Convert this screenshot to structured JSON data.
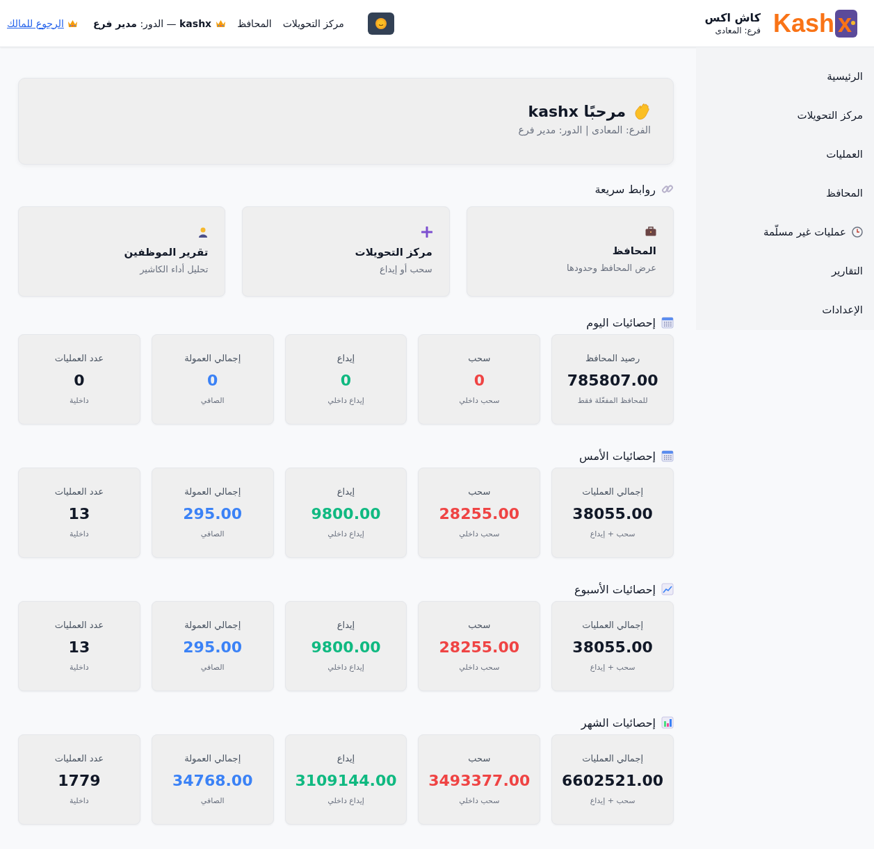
{
  "header": {
    "brand_logo": "Kash",
    "brand_logo_x": "x",
    "brand_name": "كاش اكس",
    "branch": "فرع: المعادى",
    "nav_links": [
      "مركز التحويلات",
      "المحافظ"
    ],
    "user_info": "**kashx** — الدور: **مدير فرع**",
    "back_link": "الرجوع للمالك"
  },
  "sidebar": {
    "items": [
      {
        "label": "الرئيسية",
        "kind": "plain"
      },
      {
        "label": "مركز التحويلات",
        "kind": "plain"
      },
      {
        "label": "العمليات",
        "kind": "plain"
      },
      {
        "label": "المحافظ",
        "kind": "plain"
      },
      {
        "label": "عمليات غير مسلّمة",
        "kind": "clock"
      },
      {
        "label": "التقارير",
        "kind": "plain"
      },
      {
        "label": "الإعدادات",
        "kind": "plain"
      }
    ]
  },
  "welcome": {
    "title": "مرحبًا kashx",
    "subtitle": "الفرع: المعادى | الدور: مدير فرع"
  },
  "quick_links": {
    "title": "روابط سريعة",
    "items": [
      {
        "title": "المحافظ",
        "subtitle": "عرض المحافظ وحدودها",
        "kind": "briefcase"
      },
      {
        "title": "مركز التحويلات",
        "subtitle": "سحب أو إيداع",
        "kind": "plus"
      },
      {
        "title": "تقرير الموظفين",
        "subtitle": "تحليل أداء الكاشير",
        "kind": "person"
      }
    ]
  },
  "sections": [
    {
      "title": "إحصائيات اليوم",
      "kind": "calendar",
      "stats": [
        {
          "label": "رصيد المحافظ",
          "value": "785807.00",
          "note": "للمحافظ المفعّلة فقط",
          "kind": "total"
        },
        {
          "label": "سحب",
          "value": "0",
          "note": "سحب داخلي",
          "kind": "withdraw"
        },
        {
          "label": "إيداع",
          "value": "0",
          "note": "إيداع داخلي",
          "kind": "deposit"
        },
        {
          "label": "إجمالي العمولة",
          "value": "0",
          "note": "الصافي",
          "kind": "commission"
        },
        {
          "label": "عدد العمليات",
          "value": "0",
          "note": "داخلية",
          "kind": "count"
        }
      ]
    },
    {
      "title": "إحصائيات الأمس",
      "kind": "calendar",
      "stats": [
        {
          "label": "إجمالي العمليات",
          "value": "38055.00",
          "note": "سحب + إيداع",
          "kind": "total"
        },
        {
          "label": "سحب",
          "value": "28255.00",
          "note": "سحب داخلي",
          "kind": "withdraw"
        },
        {
          "label": "إيداع",
          "value": "9800.00",
          "note": "إيداع داخلي",
          "kind": "deposit"
        },
        {
          "label": "إجمالي العمولة",
          "value": "295.00",
          "note": "الصافي",
          "kind": "commission"
        },
        {
          "label": "عدد العمليات",
          "value": "13",
          "note": "داخلية",
          "kind": "count"
        }
      ]
    },
    {
      "title": "إحصائيات الأسبوع",
      "kind": "trend",
      "stats": [
        {
          "label": "إجمالي العمليات",
          "value": "38055.00",
          "note": "سحب + إيداع",
          "kind": "total"
        },
        {
          "label": "سحب",
          "value": "28255.00",
          "note": "سحب داخلي",
          "kind": "withdraw"
        },
        {
          "label": "إيداع",
          "value": "9800.00",
          "note": "إيداع داخلي",
          "kind": "deposit"
        },
        {
          "label": "إجمالي العمولة",
          "value": "295.00",
          "note": "الصافي",
          "kind": "commission"
        },
        {
          "label": "عدد العمليات",
          "value": "13",
          "note": "داخلية",
          "kind": "count"
        }
      ]
    },
    {
      "title": "إحصائيات الشهر",
      "kind": "bars",
      "stats": [
        {
          "label": "إجمالي العمليات",
          "value": "6602521.00",
          "note": "سحب + إيداع",
          "kind": "total"
        },
        {
          "label": "سحب",
          "value": "3493377.00",
          "note": "سحب داخلي",
          "kind": "withdraw"
        },
        {
          "label": "إيداع",
          "value": "3109144.00",
          "note": "إيداع داخلي",
          "kind": "deposit"
        },
        {
          "label": "إجمالي العمولة",
          "value": "34768.00",
          "note": "الصافي",
          "kind": "commission"
        },
        {
          "label": "عدد العمليات",
          "value": "1779",
          "note": "داخلية",
          "kind": "count"
        }
      ]
    }
  ]
}
